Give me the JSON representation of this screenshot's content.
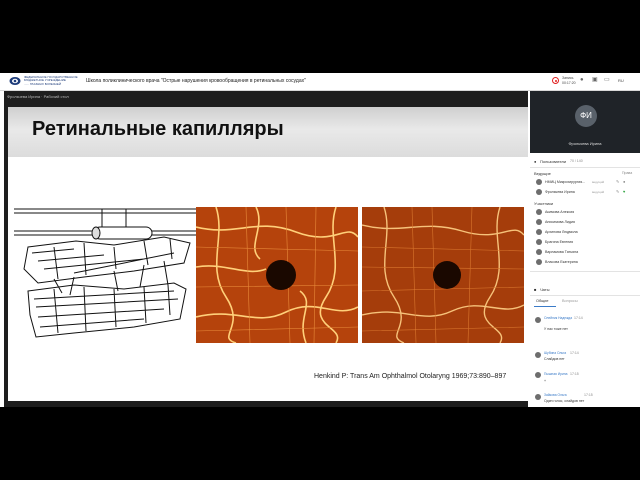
{
  "header": {
    "org_lines": [
      "ФЕДЕРАЛЬНОЕ ГОСУДАРСТВЕННОЕ",
      "БЮДЖЕТНОЕ УЧРЕЖДЕНИЕ",
      "...... ГЛАЗНЫХ БОЛЕЗНЕЙ"
    ],
    "title": "Школа поликлинического врача \"Острые нарушения кровообращения в ретинальных сосудах\"",
    "record_label": "Запись",
    "record_time": "00:17:20",
    "lang": "RU"
  },
  "stage": {
    "presenter_label": "Фрольчева Ирина · Рабочий стол",
    "slide_title": "Ретинальные капилляры",
    "citation": "Henkind P: Trans Am Ophthalmol Otolaryng 1969;73:890–897"
  },
  "sidebar": {
    "camera": {
      "initials": "ФИ",
      "name": "Фрольчева Ирина"
    },
    "users_label": "Пользователи",
    "users_count": "70 / 140",
    "hosts_label": "Ведущие",
    "rights_label": "Права",
    "hosts": [
      {
        "initials": "НМ",
        "name": "НМИЦ Микрохирургия...",
        "role": "ведущий"
      },
      {
        "initials": "ФИ",
        "name": "Фрольчева Ирина",
        "role": "ведущий"
      }
    ],
    "participants_label": "Участники",
    "participants": [
      {
        "initials": "АА",
        "name": "Акимова Алексия"
      },
      {
        "initials": "АЛ",
        "name": "Анисимова Лидия"
      },
      {
        "initials": "АЛ",
        "name": "Архипова Людмила"
      },
      {
        "initials": "БЕ",
        "name": "Брагина Евгения"
      },
      {
        "initials": "ВТ",
        "name": "Варламова Татьяна"
      },
      {
        "initials": "ВЕ",
        "name": "Власова Екатерина"
      }
    ],
    "chats_label": "Чаты",
    "chat_tabs": [
      "Общие",
      "Вопросы"
    ],
    "messages": [
      {
        "name": "Олейник Надежда",
        "time": "17:14",
        "text": "У нас тоже нет"
      },
      {
        "name": "Шубина Ольга",
        "time": "17:14",
        "text": "Слайдов нет"
      },
      {
        "name": "Пышная Ирина",
        "time": "17:15",
        "text": "+"
      },
      {
        "name": "Зайкова Ольга",
        "time": "17:15",
        "text": "Один голос, слайдов нет"
      }
    ]
  },
  "colors": {
    "accent": "#3b7bc8",
    "record": "#e02020",
    "stage": "#1e1e1e",
    "sidebar_camera": "#1f2328"
  },
  "icons": [
    "logo-icon",
    "record-icon",
    "mic-icon",
    "camera-icon",
    "screen-icon",
    "settings-icon",
    "users-icon",
    "chat-icon"
  ]
}
